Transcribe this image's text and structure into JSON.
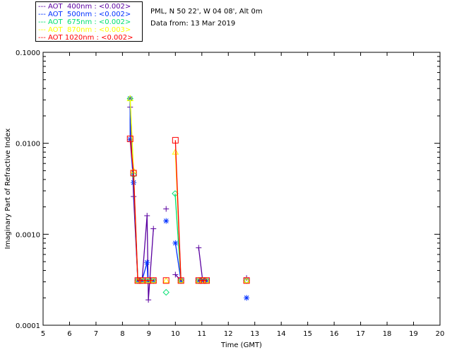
{
  "header": {
    "site": "PML, N 50 22', W 04 08', Alt 0m",
    "date": "Data from: 13 Mar 2019"
  },
  "chart_data": {
    "type": "scatter",
    "xlabel": "Time (GMT)",
    "ylabel": "Imaginary Part of Refractive Index",
    "xlim": [
      5,
      20
    ],
    "ylim": [
      0.0001,
      0.1
    ],
    "yscale": "log",
    "xticks": [
      "5",
      "6",
      "7",
      "8",
      "9",
      "10",
      "11",
      "12",
      "13",
      "14",
      "15",
      "16",
      "17",
      "18",
      "19",
      "20"
    ],
    "yticks": [
      "0.1000",
      "0.0100",
      "0.0010",
      "0.0001"
    ],
    "legend_position": "top-left outside",
    "series": [
      {
        "name": "AOT  400nm : <0.002>",
        "color": "#5a00a0",
        "marker": "plus",
        "runs": [
          [
            [
              8.29,
              0.031
            ],
            [
              8.29,
              0.025
            ],
            [
              8.42,
              0.0026
            ],
            [
              8.58,
              0.00031
            ],
            [
              8.74,
              0.00031
            ],
            [
              8.93,
              0.0016
            ],
            [
              8.98,
              0.00019
            ],
            [
              9.17,
              0.00115
            ]
          ],
          [
            [
              9.65,
              0.0019
            ]
          ],
          [
            [
              10.0,
              0.00036
            ],
            [
              10.21,
              0.00031
            ]
          ],
          [
            [
              10.88,
              0.00071
            ],
            [
              11.03,
              0.00031
            ],
            [
              11.18,
              0.00031
            ]
          ],
          [
            [
              12.69,
              0.00033
            ]
          ]
        ]
      },
      {
        "name": "AOT  500nm : <0.002>",
        "color": "#0030ff",
        "marker": "asterisk",
        "runs": [
          [
            [
              8.29,
              0.031
            ],
            [
              8.29,
              0.011
            ],
            [
              8.42,
              0.0037
            ],
            [
              8.58,
              0.00031
            ],
            [
              8.74,
              0.00031
            ],
            [
              8.93,
              0.00049
            ],
            [
              8.96,
              0.00031
            ],
            [
              9.17,
              0.00031
            ]
          ],
          [
            [
              9.65,
              0.0014
            ]
          ],
          [
            [
              10.0,
              0.0008
            ],
            [
              10.21,
              0.00031
            ]
          ],
          [
            [
              10.88,
              0.00031
            ],
            [
              11.03,
              0.00031
            ],
            [
              11.18,
              0.00031
            ]
          ],
          [
            [
              12.69,
              0.0002
            ]
          ]
        ]
      },
      {
        "name": "AOT  675nm : <0.002>",
        "color": "#00e070",
        "marker": "diamond",
        "runs": [
          [
            [
              8.29,
              0.031
            ],
            [
              8.42,
              0.0045
            ],
            [
              8.58,
              0.00031
            ],
            [
              8.74,
              0.00031
            ],
            [
              8.96,
              0.00031
            ],
            [
              9.17,
              0.00031
            ]
          ],
          [
            [
              9.65,
              0.00023
            ]
          ],
          [
            [
              9.99,
              0.0028
            ],
            [
              10.21,
              0.00031
            ]
          ],
          [
            [
              10.88,
              0.00031
            ],
            [
              11.03,
              0.00031
            ],
            [
              11.18,
              0.00031
            ]
          ],
          [
            [
              12.69,
              0.00031
            ]
          ]
        ]
      },
      {
        "name": "AOT  870nm : <0.003>",
        "color": "#ffff00",
        "marker": "triangle",
        "runs": [
          [
            [
              8.29,
              0.031
            ],
            [
              8.42,
              0.005
            ],
            [
              8.58,
              0.00031
            ],
            [
              8.74,
              0.00031
            ],
            [
              8.96,
              0.00031
            ],
            [
              9.17,
              0.00031
            ]
          ],
          [
            [
              9.65,
              0.00031
            ]
          ],
          [
            [
              10.0,
              0.008
            ],
            [
              10.21,
              0.00031
            ]
          ],
          [
            [
              10.88,
              0.00031
            ],
            [
              11.03,
              0.00031
            ],
            [
              11.18,
              0.00031
            ]
          ],
          [
            [
              12.69,
              0.00031
            ]
          ]
        ]
      },
      {
        "name": "AOT 1020nm : <0.002>",
        "color": "#ff0000",
        "marker": "square",
        "runs": [
          [
            [
              8.29,
              0.0112
            ],
            [
              8.42,
              0.0047
            ],
            [
              8.58,
              0.00031
            ],
            [
              8.74,
              0.00031
            ],
            [
              8.96,
              0.00031
            ],
            [
              9.17,
              0.00031
            ]
          ],
          [
            [
              9.65,
              0.00031
            ]
          ],
          [
            [
              10.0,
              0.0108
            ],
            [
              10.21,
              0.00031
            ]
          ],
          [
            [
              10.88,
              0.00031
            ],
            [
              11.03,
              0.00031
            ],
            [
              11.18,
              0.00031
            ]
          ],
          [
            [
              12.69,
              0.00031
            ]
          ]
        ]
      }
    ]
  }
}
